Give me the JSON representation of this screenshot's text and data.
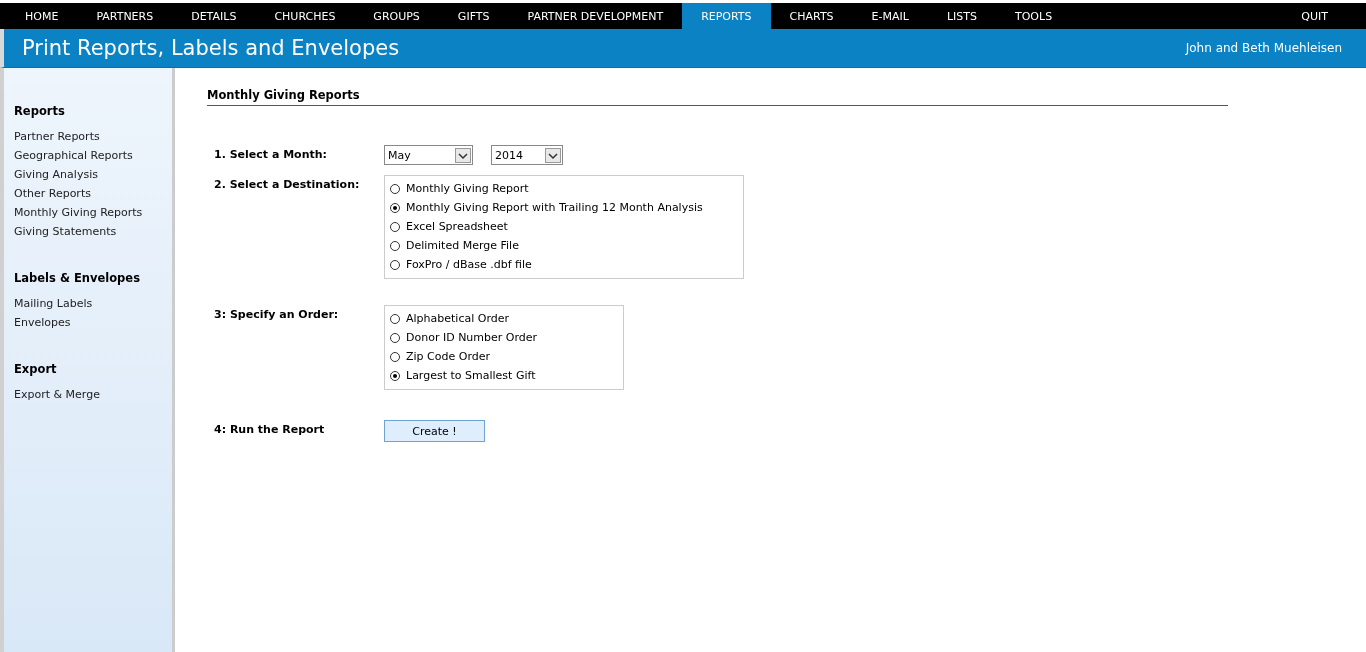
{
  "nav": [
    {
      "label": "HOME",
      "selected": false
    },
    {
      "label": "PARTNERS",
      "selected": false
    },
    {
      "label": "DETAILS",
      "selected": false
    },
    {
      "label": "CHURCHES",
      "selected": false
    },
    {
      "label": "GROUPS",
      "selected": false
    },
    {
      "label": "GIFTS",
      "selected": false
    },
    {
      "label": "PARTNER DEVELOPMENT",
      "selected": false
    },
    {
      "label": "REPORTS",
      "selected": true
    },
    {
      "label": "CHARTS",
      "selected": false
    },
    {
      "label": "E-MAIL",
      "selected": false
    },
    {
      "label": "LISTS",
      "selected": false
    },
    {
      "label": "TOOLS",
      "selected": false
    }
  ],
  "quit": "QUIT",
  "header": {
    "title": "Print Reports, Labels and Envelopes",
    "user": "John and Beth Muehleisen"
  },
  "sidebar": [
    {
      "heading": "Reports",
      "items": [
        "Partner Reports",
        "Geographical Reports",
        "Giving Analysis",
        "Other Reports",
        "Monthly Giving Reports",
        "Giving Statements"
      ]
    },
    {
      "heading": "Labels & Envelopes",
      "items": [
        "Mailing Labels",
        "Envelopes"
      ]
    },
    {
      "heading": "Export",
      "items": [
        "Export & Merge"
      ]
    }
  ],
  "content": {
    "heading": "Monthly Giving Reports",
    "month": {
      "label": "1.  Select a Month:",
      "month": "May",
      "year": "2014"
    },
    "destination": {
      "label": "2. Select a Destination:",
      "options": [
        {
          "label": "Monthly Giving Report",
          "selected": false
        },
        {
          "label": "Monthly Giving Report with Trailing 12 Month Analysis",
          "selected": true
        },
        {
          "label": "Excel Spreadsheet",
          "selected": false
        },
        {
          "label": "Delimited Merge File",
          "selected": false
        },
        {
          "label": "FoxPro / dBase .dbf file",
          "selected": false
        }
      ]
    },
    "order": {
      "label": "3: Specify an Order:",
      "options": [
        {
          "label": "Alphabetical Order",
          "selected": false
        },
        {
          "label": "Donor ID Number Order",
          "selected": false
        },
        {
          "label": "Zip Code Order",
          "selected": false
        },
        {
          "label": "Largest to Smallest Gift",
          "selected": true
        }
      ]
    },
    "run": {
      "label": "4: Run the Report",
      "button": "Create !"
    }
  }
}
